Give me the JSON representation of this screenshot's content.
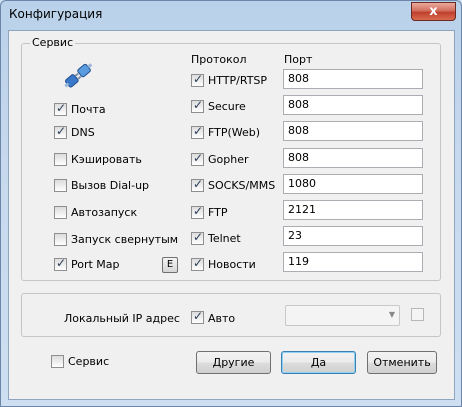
{
  "window": {
    "title": "Конфигурация",
    "close_glyph": "x"
  },
  "service_group": {
    "legend": "Сервис",
    "icon": "plug-connect-icon",
    "options": [
      {
        "label": "Почта",
        "checked": true
      },
      {
        "label": "DNS",
        "checked": true
      },
      {
        "label": "Кэшировать",
        "checked": false
      },
      {
        "label": "Вызов Dial-up",
        "checked": false
      },
      {
        "label": "Автозапуск",
        "checked": false
      },
      {
        "label": "Запуск свернутым",
        "checked": false
      },
      {
        "label": "Port Map",
        "checked": true
      }
    ],
    "portmap_button": "E",
    "col_protocol": "Протокол",
    "col_port": "Порт",
    "protocols": [
      {
        "label": "HTTP/RTSP",
        "checked": true,
        "port": "808"
      },
      {
        "label": "Secure",
        "checked": true,
        "port": "808"
      },
      {
        "label": "FTP(Web)",
        "checked": true,
        "port": "808"
      },
      {
        "label": "Gopher",
        "checked": true,
        "port": "808"
      },
      {
        "label": "SOCKS/MMS",
        "checked": true,
        "port": "1080"
      },
      {
        "label": "FTP",
        "checked": true,
        "port": "2121"
      },
      {
        "label": "Telnet",
        "checked": true,
        "port": "23"
      },
      {
        "label": "Новости",
        "checked": true,
        "port": "119"
      }
    ]
  },
  "local_ip": {
    "label": "Локальный IP адрес",
    "auto_label": "Авто",
    "auto_checked": true,
    "value": ""
  },
  "footer": {
    "service_label": "Сервис",
    "service_checked": false,
    "other_button": "Другие",
    "ok_button": "Да",
    "cancel_button": "Отменить"
  }
}
